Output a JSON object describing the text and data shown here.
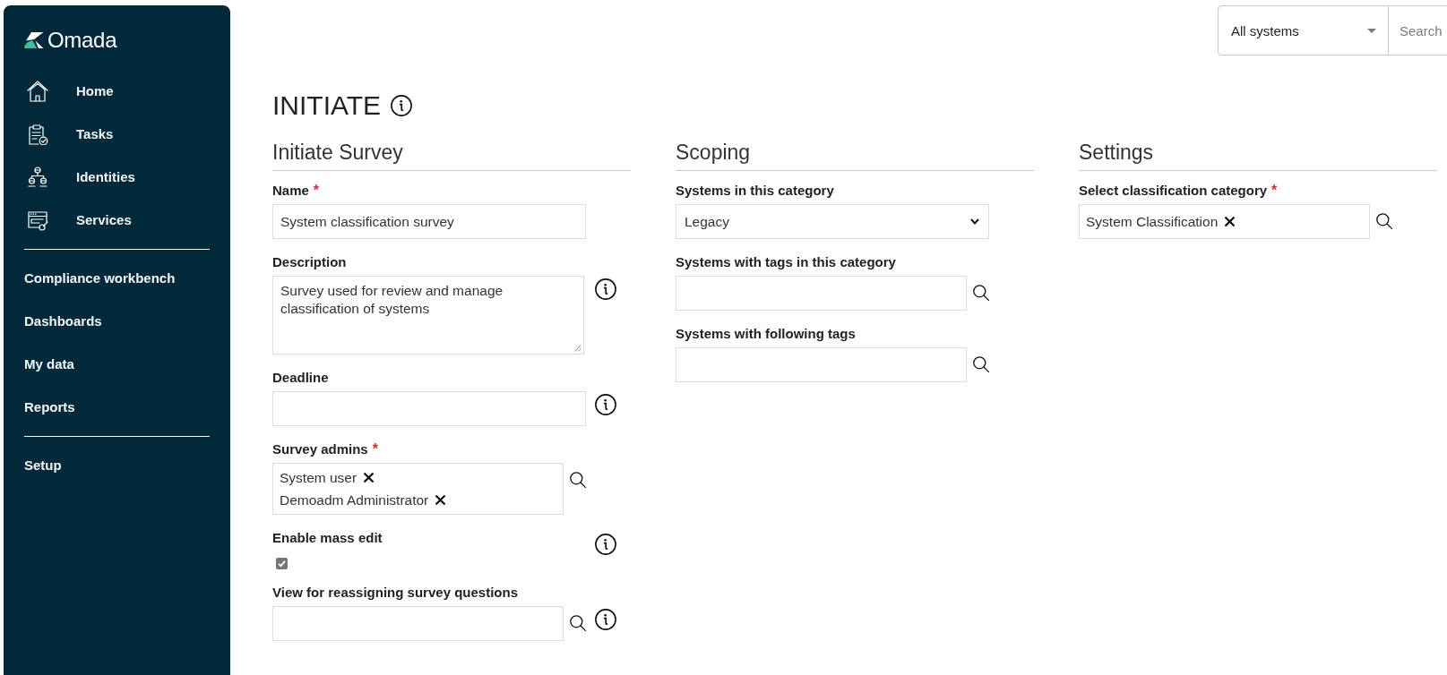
{
  "sidebar": {
    "logo": "Omada",
    "sections": [
      {
        "items": [
          {
            "label": "Home",
            "kind": "icon"
          },
          {
            "label": "Tasks",
            "kind": "icon"
          },
          {
            "label": "Identities",
            "kind": "icon"
          },
          {
            "label": "Services",
            "kind": "icon"
          }
        ]
      },
      {
        "items": [
          {
            "label": "Compliance workbench",
            "kind": "text"
          },
          {
            "label": "Dashboards",
            "kind": "text"
          },
          {
            "label": "My data",
            "kind": "text"
          },
          {
            "label": "Reports",
            "kind": "text"
          }
        ]
      },
      {
        "items": [
          {
            "label": "Setup",
            "kind": "text"
          }
        ]
      }
    ]
  },
  "top_bar": {
    "system_filter": {
      "value": "All systems"
    },
    "search": {
      "placeholder": "Search"
    }
  },
  "page": {
    "title": "INITIATE",
    "info": true
  },
  "columns": [
    {
      "title": "Initiate Survey",
      "fields": [
        {
          "kind": "text",
          "label": "Name",
          "required_mark": "*",
          "info": false,
          "value": "System classification survey"
        },
        {
          "kind": "textarea",
          "label": "Description",
          "info": true,
          "value": "Survey used for review and manage classification of systems"
        },
        {
          "kind": "text",
          "label": "Deadline",
          "info": true
        },
        {
          "kind": "lookup",
          "label": "Survey admins",
          "required_mark": "*",
          "info": false,
          "tags": [
            "System user",
            "Demoadm Administrator"
          ]
        },
        {
          "kind": "checkbox",
          "label": "Enable mass edit",
          "info": true,
          "checked": true
        },
        {
          "kind": "lookup",
          "label": "View for reassigning survey questions",
          "info": true
        }
      ]
    },
    {
      "title": "Scoping",
      "fields": [
        {
          "kind": "select",
          "label": "Systems in this category",
          "info": false,
          "value": "Legacy"
        },
        {
          "kind": "lookup",
          "label": "Systems with tags in this category",
          "info": false
        },
        {
          "kind": "lookup",
          "label": "Systems with following tags",
          "info": false
        }
      ]
    },
    {
      "title": "Settings",
      "fields": [
        {
          "kind": "lookup",
          "label": "Select classification category",
          "required_mark": "*",
          "info": false,
          "tags": [
            "System Classification"
          ]
        }
      ]
    }
  ]
}
